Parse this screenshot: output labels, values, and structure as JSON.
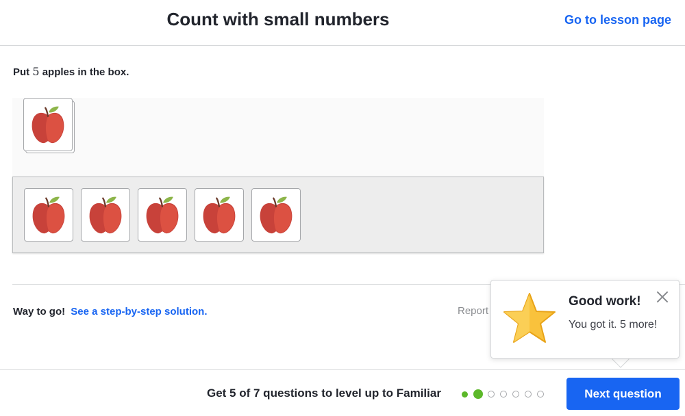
{
  "header": {
    "title": "Count with small numbers",
    "lesson_link": "Go to lesson page"
  },
  "question": {
    "prompt_before": "Put ",
    "prompt_number": "5",
    "prompt_after": " apples in the box.",
    "item_icon": "apple-icon",
    "items_in_box": 5
  },
  "feedback": {
    "message": "Way to go!",
    "solution_link": "See a step-by-step solution.",
    "report": "Report"
  },
  "popup": {
    "title": "Good work!",
    "message": "You got it. 5 more!",
    "icon": "star-icon",
    "close_icon": "close-icon"
  },
  "footer": {
    "progress_text": "Get 5 of 7 questions to level up to Familiar",
    "dots": [
      "filled",
      "current",
      "empty",
      "empty",
      "empty",
      "empty",
      "empty"
    ],
    "next_button": "Next question"
  },
  "colors": {
    "accent": "#1865f2",
    "progress_green": "#5cb82a",
    "apple_red": "#d9483b",
    "star_gold": "#f7b731"
  }
}
